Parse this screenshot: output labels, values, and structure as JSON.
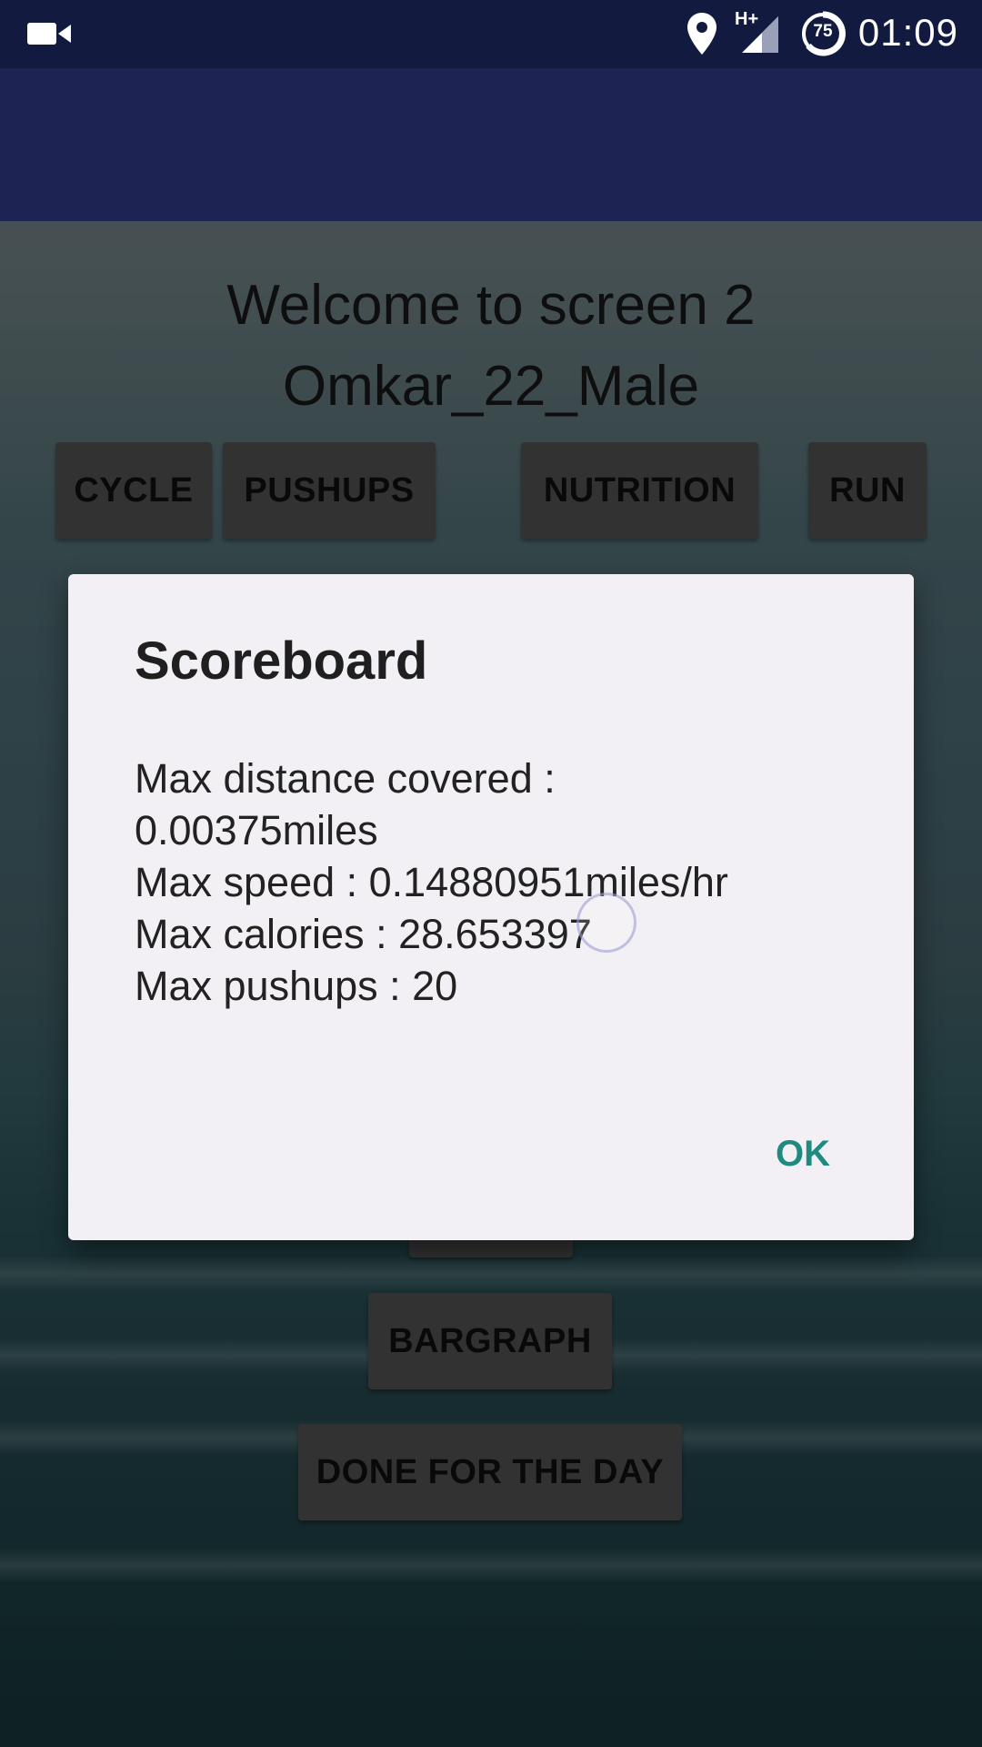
{
  "status_bar": {
    "icons": [
      "video-camera-icon",
      "location-pin-icon",
      "hplus-network-icon",
      "battery-icon"
    ],
    "network_label": "H+",
    "battery_level": "75",
    "time": "01:09"
  },
  "main": {
    "welcome_line1": "Welcome to screen 2",
    "welcome_line2": "Omkar_22_Male",
    "buttons": {
      "cycle": "CYCLE",
      "pushups": "PUSHUPS",
      "nutrition": "NUTRITION",
      "run": "RUN",
      "bargraph": "BARGRAPH",
      "done": "DONE FOR THE DAY"
    }
  },
  "dialog": {
    "title": "Scoreboard",
    "lines": [
      "Max distance covered :",
      "0.00375miles",
      "Max speed : 0.14880951miles/hr",
      "Max calories : 28.653397",
      "Max pushups : 20"
    ],
    "ok_label": "OK"
  },
  "colors": {
    "status_bar": "#121a3f",
    "app_bar": "#1d2352",
    "dialog_bg": "#f2f0f4",
    "accent": "#1f8a80"
  }
}
